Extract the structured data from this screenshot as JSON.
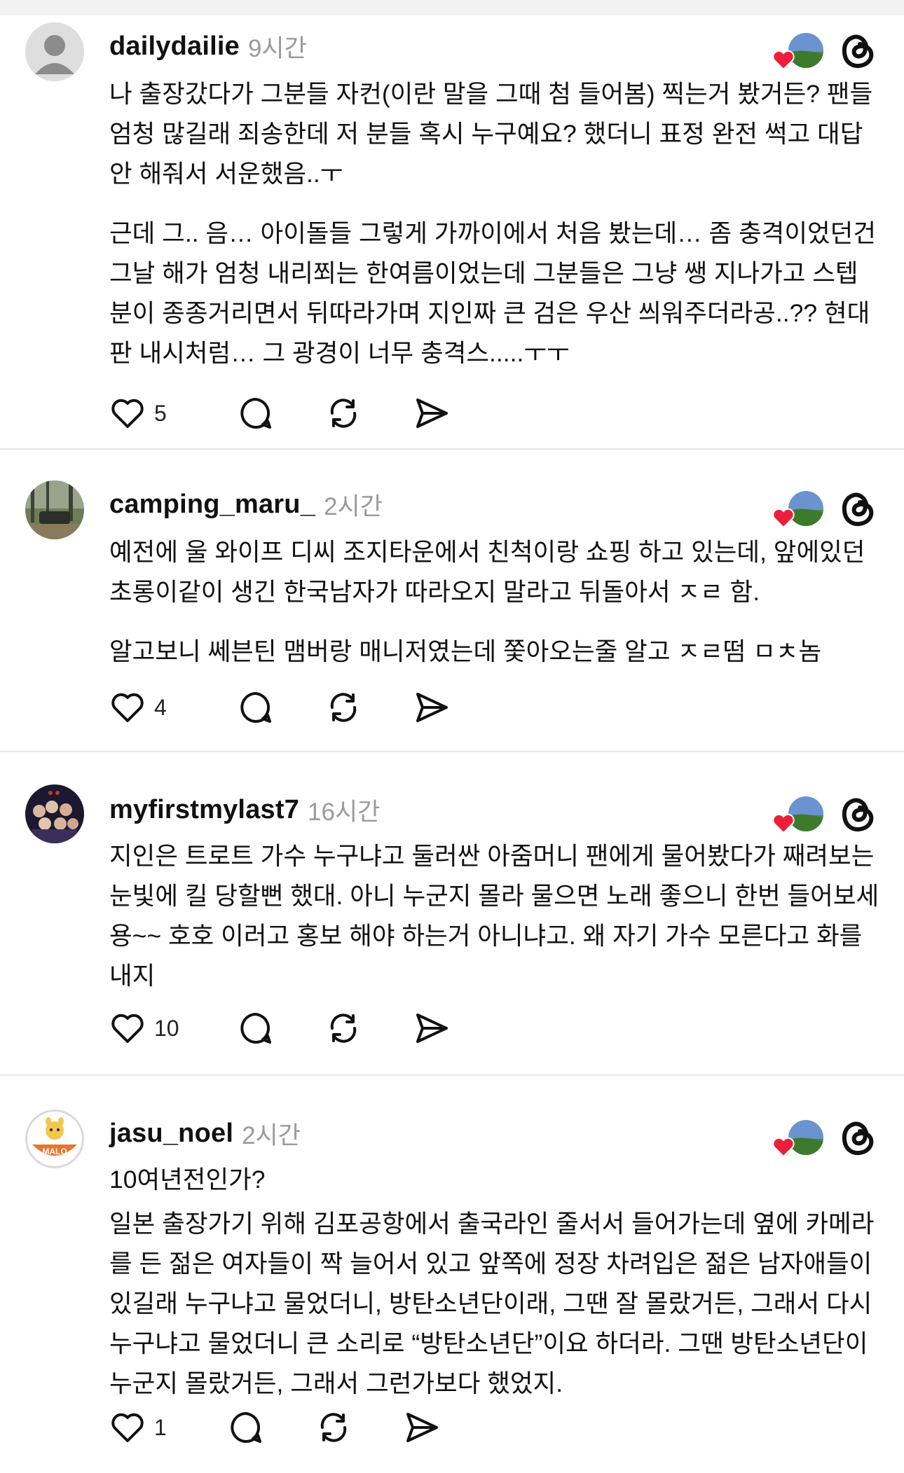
{
  "posts": [
    {
      "username": "dailydailie",
      "time": "9시간",
      "avatar": "default-avatar",
      "paragraphs": [
        "나 출장갔다가 그분들 자컨(이란 말을 그때 첨 들어봄) 찍는거 봤거든? 팬들 엄청 많길래 죄송한데 저 분들 혹시 누구예요? 했더니 표정 완전 썩고 대답 안 해줘서 서운했음..ㅜ",
        "근데 그.. 음… 아이돌들 그렇게 가까이에서 처음 봤는데… 좀 충격이었던건 그날 해가 엄청 내리쬐는 한여름이었는데 그분들은 그냥 쌩 지나가고 스텝분이 종종거리면서 뒤따라가며 지인짜 큰 검은 우산 씌워주더라공..?? 현대판 내시처럼… 그 광경이 너무 충격스.....ㅜㅜ"
      ],
      "like_count": "5"
    },
    {
      "username": "camping_maru_",
      "time": "2시간",
      "avatar": "forest-car-photo",
      "paragraphs": [
        "예전에 울 와이프 디씨 조지타운에서 친척이랑 쇼핑 하고 있는데, 앞에있던 초롱이같이 생긴 한국남자가 따라오지 말라고 뒤돌아서 ㅈㄹ 함.",
        "알고보니 쎄븐틴 맴버랑 매니저였는데 쫓아오는줄 알고 ㅈㄹ떰 ㅁㅊ놈"
      ],
      "like_count": "4"
    },
    {
      "username": "myfirstmylast7",
      "time": "16시간",
      "avatar": "group-photo",
      "paragraphs": [
        "지인은 트로트 가수 누구냐고 둘러싼 아줌머니 팬에게 물어봤다가 째려보는 눈빛에 킬 당할뻔 했대. 아니 누군지 몰라 물으면 노래 좋으니 한번 들어보세용~~ 호호  이러고 홍보 해야 하는거 아니냐고. 왜 자기 가수 모른다고 화를 내지"
      ],
      "like_count": "10"
    },
    {
      "username": "jasu_noel",
      "time": "2시간",
      "avatar": "malo-logo",
      "avatar_text": "MALO",
      "paragraphs": [
        "10여년전인가?",
        "일본 출장가기 위해 김포공항에서 출국라인 줄서서 들어가는데 옆에 카메라를 든 젊은 여자들이 짝 늘어서 있고 앞쪽에 정장 차려입은 젊은 남자애들이 있길래 누구냐고 물었더니, 방탄소년단이래, 그땐 잘 몰랐거든, 그래서 다시 누구냐고 물었더니 큰 소리로 “방탄소년단”이요 하더라. 그땐 방탄소년단이 누군지 몰랐거든, 그래서 그런가보다 했었지."
      ],
      "like_count": "1"
    }
  ],
  "icons": {
    "like": "heart-outline-icon",
    "reply": "speech-bubble-icon",
    "repost": "repost-icon",
    "share": "send-icon",
    "app": "threads-logo-icon",
    "liked_by": "liked-by-author-icon"
  },
  "colors": {
    "heart": "#ec1f3a",
    "muted": "#9a9a9a",
    "divider": "#e6e6e6"
  }
}
